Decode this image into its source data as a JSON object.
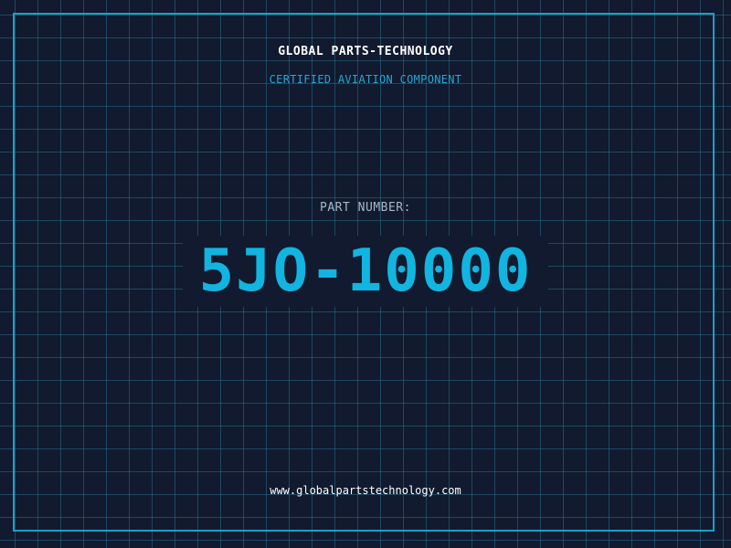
{
  "header": {
    "title": "GLOBAL PARTS-TECHNOLOGY",
    "subtitle": "CERTIFIED AVIATION COMPONENT"
  },
  "part": {
    "label": "PART NUMBER:",
    "number": "5JO-10000"
  },
  "footer": {
    "url": "www.globalpartstechnology.com"
  },
  "colors": {
    "background": "#111a2e",
    "grid": "#286e8c",
    "frame": "#1aa0c8",
    "accent": "#12b4e0",
    "subtitle": "#22a8d8"
  }
}
